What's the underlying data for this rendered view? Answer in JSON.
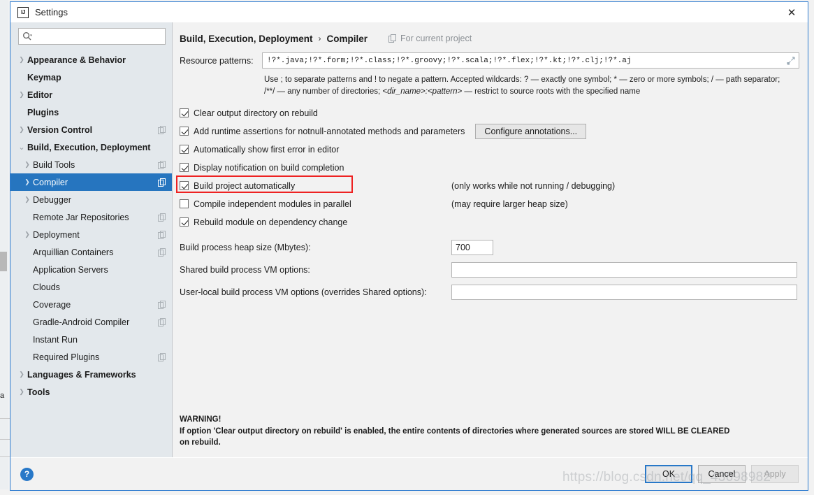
{
  "window": {
    "title": "Settings",
    "app_icon": "intellij-idea-icon",
    "close_icon": "close-icon",
    "accent_color": "#2d7bd0"
  },
  "sidebar": {
    "search": {
      "placeholder": "",
      "value": "",
      "icon": "search-icon"
    },
    "items": [
      {
        "label": "Appearance & Behavior",
        "level": 0,
        "bold": true,
        "arrow": "›",
        "copy": false,
        "selected": false
      },
      {
        "label": "Keymap",
        "level": 0,
        "bold": true,
        "arrow": "",
        "copy": false,
        "selected": false
      },
      {
        "label": "Editor",
        "level": 0,
        "bold": true,
        "arrow": "›",
        "copy": false,
        "selected": false
      },
      {
        "label": "Plugins",
        "level": 0,
        "bold": true,
        "arrow": "",
        "copy": false,
        "selected": false
      },
      {
        "label": "Version Control",
        "level": 0,
        "bold": true,
        "arrow": "›",
        "copy": true,
        "selected": false
      },
      {
        "label": "Build, Execution, Deployment",
        "level": 0,
        "bold": true,
        "arrow": "⌄",
        "copy": false,
        "selected": false
      },
      {
        "label": "Build Tools",
        "level": 1,
        "bold": false,
        "arrow": "›",
        "copy": true,
        "selected": false
      },
      {
        "label": "Compiler",
        "level": 1,
        "bold": false,
        "arrow": "›",
        "copy": true,
        "selected": true
      },
      {
        "label": "Debugger",
        "level": 1,
        "bold": false,
        "arrow": "›",
        "copy": false,
        "selected": false
      },
      {
        "label": "Remote Jar Repositories",
        "level": 1,
        "bold": false,
        "arrow": "",
        "copy": true,
        "selected": false
      },
      {
        "label": "Deployment",
        "level": 1,
        "bold": false,
        "arrow": "›",
        "copy": true,
        "selected": false
      },
      {
        "label": "Arquillian Containers",
        "level": 1,
        "bold": false,
        "arrow": "",
        "copy": true,
        "selected": false
      },
      {
        "label": "Application Servers",
        "level": 1,
        "bold": false,
        "arrow": "",
        "copy": false,
        "selected": false
      },
      {
        "label": "Clouds",
        "level": 1,
        "bold": false,
        "arrow": "",
        "copy": false,
        "selected": false
      },
      {
        "label": "Coverage",
        "level": 1,
        "bold": false,
        "arrow": "",
        "copy": true,
        "selected": false
      },
      {
        "label": "Gradle-Android Compiler",
        "level": 1,
        "bold": false,
        "arrow": "",
        "copy": true,
        "selected": false
      },
      {
        "label": "Instant Run",
        "level": 1,
        "bold": false,
        "arrow": "",
        "copy": false,
        "selected": false
      },
      {
        "label": "Required Plugins",
        "level": 1,
        "bold": false,
        "arrow": "",
        "copy": true,
        "selected": false
      },
      {
        "label": "Languages & Frameworks",
        "level": 0,
        "bold": true,
        "arrow": "›",
        "copy": false,
        "selected": false
      },
      {
        "label": "Tools",
        "level": 0,
        "bold": true,
        "arrow": "›",
        "copy": false,
        "selected": false
      }
    ],
    "selected_color": "#2675bf"
  },
  "content": {
    "breadcrumb": {
      "root": "Build, Execution, Deployment",
      "separator": "›",
      "current": "Compiler",
      "scope_label": "For current project",
      "scope_icon": "copy-scope-icon"
    },
    "resource_patterns": {
      "label": "Resource patterns:",
      "value": "!?*.java;!?*.form;!?*.class;!?*.groovy;!?*.scala;!?*.flex;!?*.kt;!?*.clj;!?*.aj",
      "placeholder": "",
      "expand_icon": "expand-icon"
    },
    "hint_line1": "Use ; to separate patterns and ! to negate a pattern. Accepted wildcards: ? — exactly one symbol; * — zero or more symbols; / — path separator;",
    "hint_line2_prefix": "/**/ — any number of directories; ",
    "hint_line2_italic": "<dir_name>:<pattern>",
    "hint_line2_suffix": " — restrict to source roots with the specified name",
    "checkboxes": [
      {
        "label": "Clear output directory on rebuild",
        "checked": true,
        "note": "",
        "highlighted": false
      },
      {
        "label": "Add runtime assertions for notnull-annotated methods and parameters",
        "checked": true,
        "note": "",
        "highlighted": false
      },
      {
        "label": "Automatically show first error in editor",
        "checked": true,
        "note": "",
        "highlighted": false
      },
      {
        "label": "Display notification on build completion",
        "checked": true,
        "note": "",
        "highlighted": false
      },
      {
        "label": "Build project automatically",
        "checked": true,
        "note": "(only works while not running / debugging)",
        "highlighted": true
      },
      {
        "label": "Compile independent modules in parallel",
        "checked": false,
        "note": "(may require larger heap size)",
        "highlighted": false
      },
      {
        "label": "Rebuild module on dependency change",
        "checked": true,
        "note": "",
        "highlighted": false
      }
    ],
    "configure_annotations_button": "Configure annotations...",
    "heap": {
      "label": "Build process heap size (Mbytes):",
      "value": "700"
    },
    "shared_vm": {
      "label": "Shared build process VM options:",
      "value": "",
      "placeholder": ""
    },
    "userlocal_vm": {
      "label": "User-local build process VM options (overrides Shared options):",
      "value": "",
      "placeholder": ""
    },
    "warning": {
      "title": "WARNING!",
      "line1": "If option 'Clear output directory on rebuild' is enabled, the entire contents of directories where generated sources are stored WILL BE CLEARED",
      "line2": "on rebuild."
    },
    "highlight_color": "#ee2222"
  },
  "footer": {
    "help_icon": "help-icon",
    "help_label": "?",
    "ok_label": "OK",
    "cancel_label": "Cancel",
    "apply_label": "Apply"
  },
  "watermark": "https://blog.csdn.net/qq_43698982",
  "background": {
    "edge_char": "a"
  }
}
